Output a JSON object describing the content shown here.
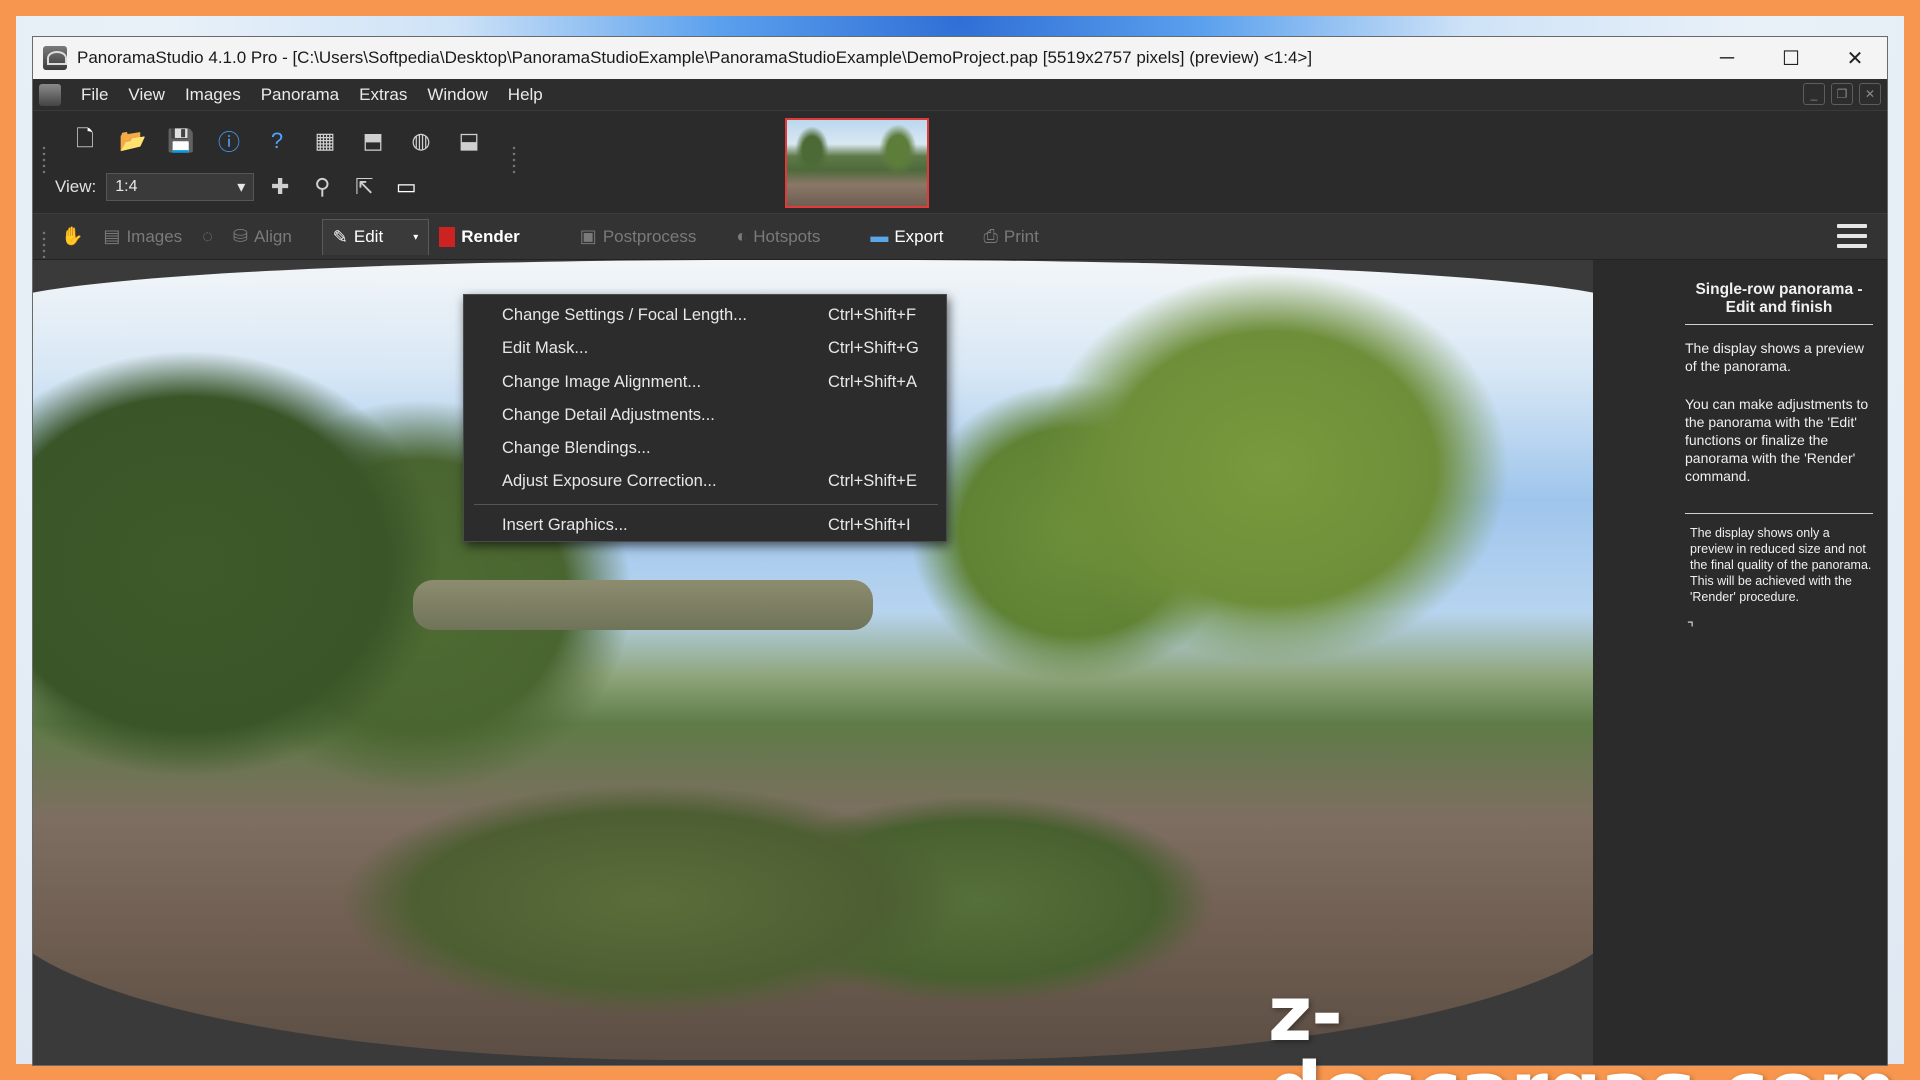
{
  "window": {
    "title": "PanoramaStudio 4.1.0 Pro - [C:\\Users\\Softpedia\\Desktop\\PanoramaStudioExample\\PanoramaStudioExample\\DemoProject.pap [5519x2757 pixels] (preview) <1:4>]",
    "minimize": "─",
    "maximize": "☐",
    "close": "✕"
  },
  "menubar": {
    "items": [
      "File",
      "View",
      "Images",
      "Panorama",
      "Extras",
      "Window",
      "Help"
    ]
  },
  "toolbar": {
    "view_label": "View:",
    "view_value": "1:4",
    "icons": [
      "new-file-icon",
      "open-folder-icon",
      "save-icon",
      "info-icon",
      "help-icon",
      "images-icon",
      "stitch-icon",
      "sphere-icon",
      "export-icon"
    ]
  },
  "workflow": {
    "images": "Images",
    "align": "Align",
    "edit": "Edit",
    "render": "Render",
    "postprocess": "Postprocess",
    "hotspots": "Hotspots",
    "export": "Export",
    "print": "Print"
  },
  "edit_menu": [
    {
      "label": "Change Settings / Focal Length...",
      "shortcut": "Ctrl+Shift+F"
    },
    {
      "label": "Edit Mask...",
      "shortcut": "Ctrl+Shift+G"
    },
    {
      "label": "Change Image Alignment...",
      "shortcut": "Ctrl+Shift+A"
    },
    {
      "label": "Change Detail Adjustments...",
      "shortcut": ""
    },
    {
      "label": "Change Blendings...",
      "shortcut": ""
    },
    {
      "label": "Adjust Exposure Correction...",
      "shortcut": "Ctrl+Shift+E"
    },
    {
      "label": "Insert Graphics...",
      "shortcut": "Ctrl+Shift+I"
    }
  ],
  "help_panel": {
    "title": "Single-row panorama - Edit and finish",
    "p1": "The display shows a preview of the panorama.",
    "p2": "You can make adjustments to the panorama with the 'Edit' functions or finalize the panorama with the 'Render' command.",
    "p3": "The display shows only a preview in reduced size and not the final quality of the panorama. This will be achieved with the 'Render' procedure.",
    "corner": "⌝"
  },
  "watermark": "z-descargas.com"
}
